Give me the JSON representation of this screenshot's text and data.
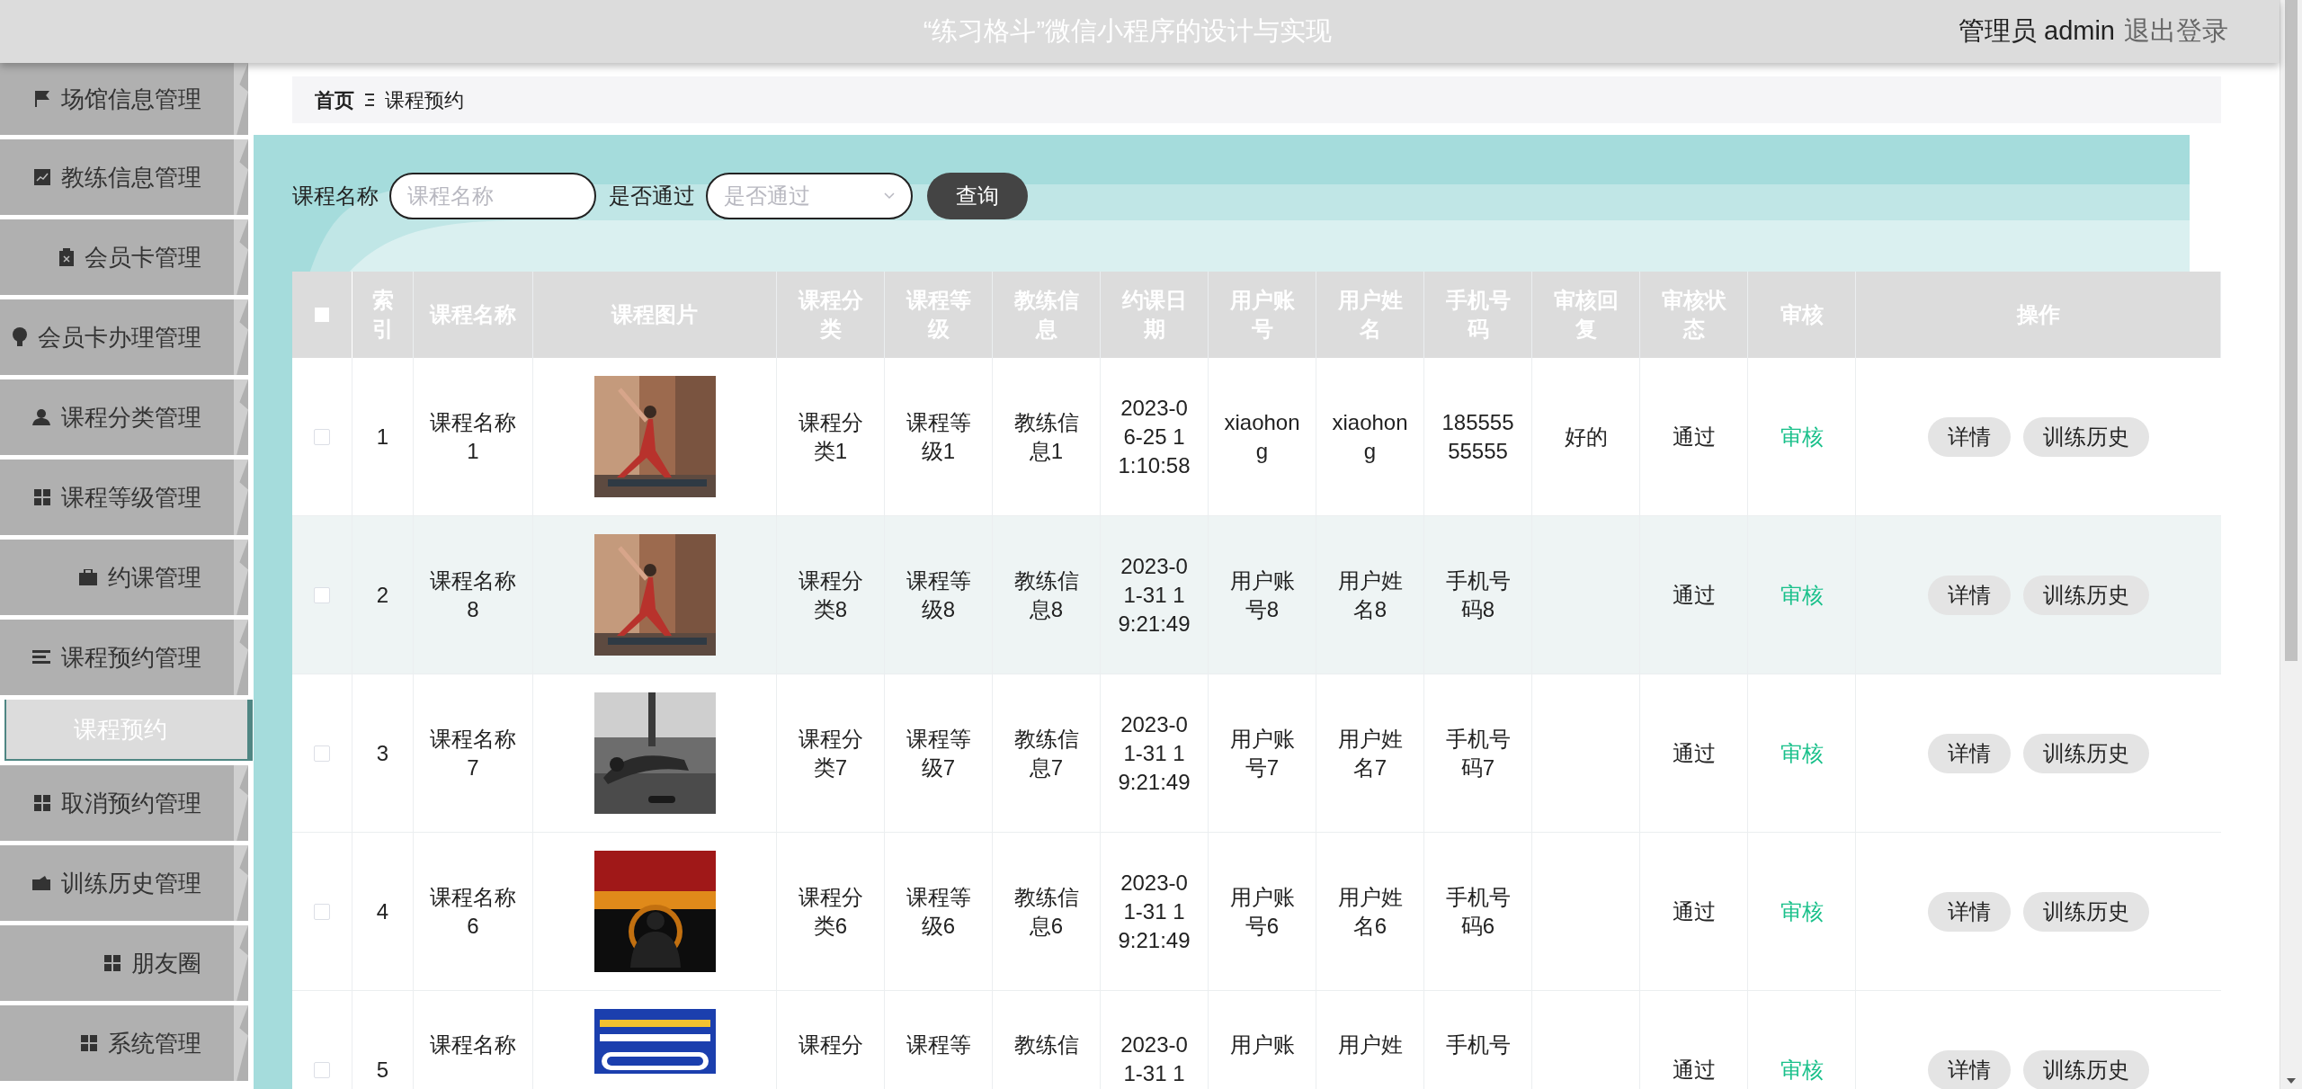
{
  "header": {
    "title": "“练习格斗”微信小程序的设计与实现",
    "user": "管理员 admin",
    "logout": "退出登录"
  },
  "sidebar": {
    "items": [
      {
        "label": "场馆信息管理"
      },
      {
        "label": "教练信息管理"
      },
      {
        "label": "会员卡管理"
      },
      {
        "label": "会员卡办理管理"
      },
      {
        "label": "课程分类管理"
      },
      {
        "label": "课程等级管理"
      },
      {
        "label": "约课管理"
      },
      {
        "label": "课程预约管理",
        "children": [
          {
            "label": "课程预约",
            "selected": true
          }
        ]
      },
      {
        "label": "取消预约管理"
      },
      {
        "label": "训练历史管理"
      },
      {
        "label": "朋友圈"
      },
      {
        "label": "系统管理"
      }
    ]
  },
  "breadcrumb": [
    "首页",
    "课程预约"
  ],
  "search": {
    "fields": [
      {
        "kind": "text",
        "label": "课程名称",
        "placeholder": "课程名称"
      },
      {
        "kind": "select",
        "label": "是否通过",
        "placeholder": "是否通过"
      }
    ],
    "button": "查询"
  },
  "table": {
    "select_all_checked": false,
    "columns": [
      "索引",
      "课程名称",
      "课程图片",
      "课程分类",
      "课程等级",
      "教练信息",
      "约课日期",
      "用户账号",
      "用户姓名",
      "手机号码",
      "审核回复",
      "审核状态",
      "审核",
      "操作"
    ],
    "rows": [
      {
        "checked": false,
        "hovered": false,
        "index": "1",
        "name": "课程名称1",
        "category": "课程分类1",
        "level": "课程等级1",
        "coach": "教练信息1",
        "date": "2023-06-25 11:10:58",
        "account": "xiaohong",
        "username": "xiaohong",
        "phone": "18555555555",
        "reply": "好的",
        "status": "通过",
        "audit": "审核",
        "actions": [
          "详情",
          "训练历史"
        ]
      },
      {
        "checked": false,
        "hovered": true,
        "index": "2",
        "name": "课程名称8",
        "category": "课程分类8",
        "level": "课程等级8",
        "coach": "教练信息8",
        "date": "2023-01-31 19:21:49",
        "account": "用户账号8",
        "username": "用户姓名8",
        "phone": "手机号码8",
        "status": "通过",
        "audit": "审核",
        "actions": [
          "详情",
          "训练历史"
        ]
      },
      {
        "checked": false,
        "hovered": false,
        "index": "3",
        "name": "课程名称7",
        "category": "课程分类7",
        "level": "课程等级7",
        "coach": "教练信息7",
        "date": "2023-01-31 19:21:49",
        "account": "用户账号7",
        "username": "用户姓名7",
        "phone": "手机号码7",
        "status": "通过",
        "audit": "审核",
        "actions": [
          "详情",
          "训练历史"
        ]
      },
      {
        "checked": false,
        "hovered": false,
        "index": "4",
        "name": "课程名称6",
        "category": "课程分类6",
        "level": "课程等级6",
        "coach": "教练信息6",
        "date": "2023-01-31 19:21:49",
        "account": "用户账号6",
        "username": "用户姓名6",
        "phone": "手机号码6",
        "status": "通过",
        "audit": "审核",
        "actions": [
          "详情",
          "训练历史"
        ]
      },
      {
        "checked": false,
        "hovered": false,
        "index": "5",
        "name": "课程名称",
        "category": "课程分",
        "level": "课程等",
        "coach": "教练信",
        "date": "2023-01-31 1",
        "account": "用户账",
        "username": "用户姓",
        "phone": "手机号",
        "status": "通过",
        "audit": "审核",
        "actions": [
          "详情",
          "训练历史"
        ]
      }
    ]
  }
}
